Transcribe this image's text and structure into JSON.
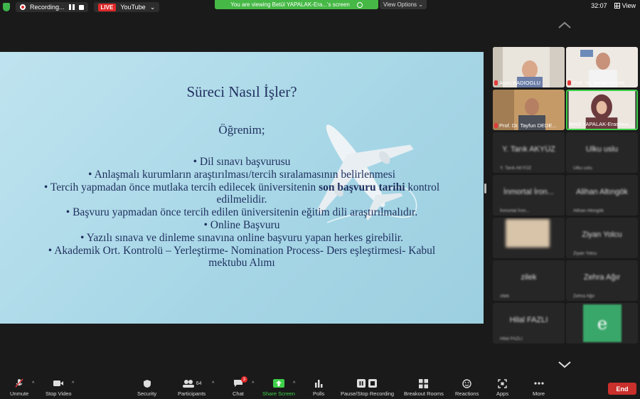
{
  "topbar": {
    "recording_label": "Recording...",
    "live_label": "LIVE",
    "stream_target": "YouTube",
    "viewing_banner": "You are viewing Betül YAPALAK-Era...'s screen",
    "view_options": "View Options",
    "timer": "32:07",
    "view_label": "View"
  },
  "slide": {
    "title": "Süreci Nasıl İşler?",
    "subtitle": "Öğrenim;",
    "bullets": [
      "• Dil sınavı başvurusu",
      "• Anlaşmalı kurumların araştırılması/tercih sıralamasının belirlenmesi",
      "• Tercih yapmadan önce mutlaka tercih edilecek üniversitenin ",
      "son başvuru tarihi",
      " kontrol edilmelidir.",
      "• Başvuru yapmadan önce tercih edilen üniversitenin eğitim dili araştırılmalıdır.",
      "• Online Başvuru",
      "• Yazılı sınava ve dinleme sınavına online başvuru yapan herkes girebilir.",
      "• Akademik Ort. Kontrolü – Yerleştirme- Nomination Process- Ders eşleştirmesi- Kabul mektubu Alımı"
    ]
  },
  "participants": [
    {
      "name": "Asım KADIOGLU"
    },
    {
      "name": "Prof. Dr. İsmail AYDIN"
    },
    {
      "name": "Prof. Dr. Tayfun DEDE..."
    },
    {
      "name": "Betül YAPALAK-Erasmus..."
    },
    {
      "name": "Y. Tarık AKYÜZ"
    },
    {
      "name": "Ulku uslu"
    },
    {
      "name": "İnmortal İron..."
    },
    {
      "name": "Alihan Altıngök"
    },
    {
      "name": ""
    },
    {
      "name": "Ziyan Yolcu"
    },
    {
      "name": "zilek"
    },
    {
      "name": "Zehra Ağır"
    },
    {
      "name": "Hilal FAZLI"
    },
    {
      "name": ""
    }
  ],
  "toolbar": {
    "unmute": "Unmute",
    "stop_video": "Stop Video",
    "security": "Security",
    "participants": "Participants",
    "participants_count": "64",
    "chat": "Chat",
    "chat_badge": "3",
    "share_screen": "Share Screen",
    "polls": "Polls",
    "recording": "Pause/Stop Recording",
    "breakout": "Breakout Rooms",
    "reactions": "Reactions",
    "apps": "Apps",
    "more": "More",
    "end": "End"
  },
  "colors": {
    "accent_green": "#3fd04a",
    "end_red": "#c9302c",
    "live_red": "#e02828",
    "slide_bg": "#a6d6e6",
    "slide_text": "#1f2f5e"
  }
}
